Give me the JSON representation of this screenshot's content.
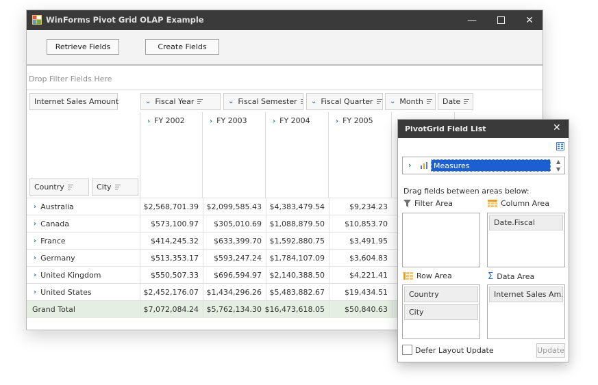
{
  "window": {
    "title": "WinForms Pivot Grid OLAP Example"
  },
  "toolbar": {
    "retrieve_label": "Retrieve Fields",
    "create_label": "Create Fields"
  },
  "filter_area": {
    "hint": "Drop Filter Fields Here"
  },
  "data_field": "Internet Sales Amount",
  "column_fields": [
    "Fiscal Year",
    "Fiscal Semester",
    "Fiscal Quarter",
    "Month",
    "Date"
  ],
  "row_fields": [
    "Country",
    "City"
  ],
  "columns": [
    "FY 2002",
    "FY 2003",
    "FY 2004",
    "FY 2005"
  ],
  "rows": [
    {
      "label": "Australia",
      "values": [
        "$2,568,701.39",
        "$2,099,585.43",
        "$4,383,479.54",
        "$9,234.23"
      ]
    },
    {
      "label": "Canada",
      "values": [
        "$573,100.97",
        "$305,010.69",
        "$1,088,879.50",
        "$10,853.70"
      ]
    },
    {
      "label": "France",
      "values": [
        "$414,245.32",
        "$633,399.70",
        "$1,592,880.75",
        "$3,491.95"
      ]
    },
    {
      "label": "Germany",
      "values": [
        "$513,353.17",
        "$593,247.24",
        "$1,784,107.09",
        "$3,604.83"
      ]
    },
    {
      "label": "United Kingdom",
      "values": [
        "$550,507.33",
        "$696,594.97",
        "$2,140,388.50",
        "$4,221.41"
      ]
    },
    {
      "label": "United States",
      "values": [
        "$2,452,176.07",
        "$1,434,296.26",
        "$5,483,882.67",
        "$19,434.51"
      ]
    }
  ],
  "grand_total": {
    "label": "Grand Total",
    "values": [
      "$7,072,084.24",
      "$5,762,134.30",
      "$16,473,618.05",
      "$50,840.63"
    ]
  },
  "field_list": {
    "title": "PivotGrid Field List",
    "measures": "Measures",
    "drag_hint": "Drag fields between areas below:",
    "filter_area": "Filter Area",
    "column_area": "Column Area",
    "row_area": "Row Area",
    "data_area": "Data Area",
    "column_items": [
      "Date.Fiscal"
    ],
    "row_items": [
      "Country",
      "City"
    ],
    "data_items": [
      "Internet Sales Am..."
    ],
    "defer_label": "Defer Layout Update",
    "update_label": "Update"
  },
  "colors": {
    "accent": "#2a6fc9",
    "titlebar": "#3a3a3a",
    "grand_total_bg": "#e4efe1",
    "selection": "#1e5fd0"
  }
}
